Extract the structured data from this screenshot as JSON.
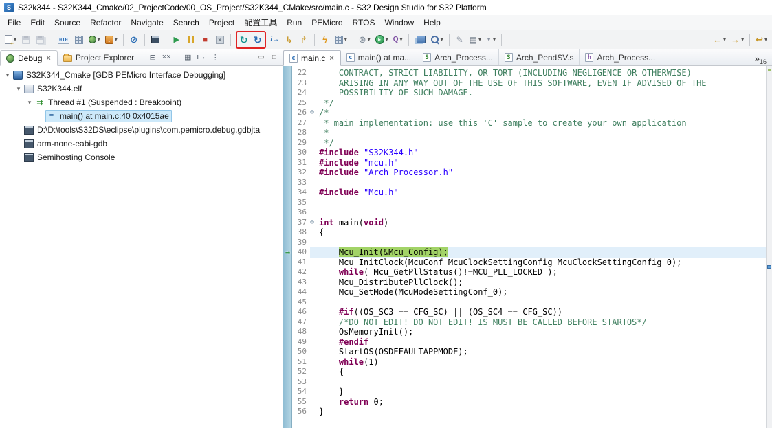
{
  "window": {
    "title": "S32k344 - S32K344_Cmake/02_ProjectCode/00_OS_Project/S32K344_CMake/src/main.c - S32 Design Studio for S32 Platform",
    "app_initial": "S"
  },
  "menubar": {
    "items": [
      "File",
      "Edit",
      "Source",
      "Refactor",
      "Navigate",
      "Search",
      "Project",
      "配置工具",
      "Run",
      "PEMicro",
      "RTOS",
      "Window",
      "Help"
    ]
  },
  "toolbar": {
    "items": [
      {
        "name": "new-wizard",
        "icon": "doc",
        "dd": true
      },
      {
        "name": "save",
        "icon": "floppy",
        "disabled": true
      },
      {
        "name": "save-all",
        "icon": "floppy2",
        "disabled": true
      },
      {
        "sep": true
      },
      {
        "name": "binary-utilities",
        "icon": "t010"
      },
      {
        "name": "view-memory",
        "icon": "grid"
      },
      {
        "name": "debug-configurations",
        "icon": "bug",
        "dd": true
      },
      {
        "name": "flash-from-file",
        "icon": "flash",
        "dd": true
      },
      {
        "sep": true
      },
      {
        "name": "skip-all-breakpoints",
        "icon": "skipbp"
      },
      {
        "sep": true
      },
      {
        "name": "open-console",
        "icon": "console"
      },
      {
        "sep": true
      },
      {
        "name": "resume",
        "icon": "resume"
      },
      {
        "name": "suspend",
        "icon": "suspend"
      },
      {
        "name": "terminate",
        "icon": "stop"
      },
      {
        "name": "disconnect",
        "icon": "disconnect"
      },
      {
        "sep": true
      },
      {
        "name": "pemicro-restart",
        "icon": "restart1",
        "boxed": true
      },
      {
        "name": "pemicro-restart-run",
        "icon": "restart2",
        "boxed": true
      },
      {
        "name": "instruction-stepping",
        "icon": "istep"
      },
      {
        "name": "step-into",
        "icon": "stepinto"
      },
      {
        "name": "step-over",
        "icon": "stepover"
      },
      {
        "sep": true
      },
      {
        "name": "flash-programmer",
        "icon": "bolt"
      },
      {
        "name": "memory-monitor",
        "icon": "grid2",
        "dd": true
      },
      {
        "sep": true
      },
      {
        "name": "external-tools",
        "icon": "gear",
        "dd": true
      },
      {
        "name": "run",
        "icon": "run",
        "dd": true
      },
      {
        "name": "profile",
        "icon": "cov",
        "dd": true
      },
      {
        "sep": true
      },
      {
        "name": "open-element",
        "icon": "books"
      },
      {
        "name": "search",
        "icon": "search",
        "dd": true
      },
      {
        "sep": true
      },
      {
        "name": "annotate",
        "icon": "pencil"
      },
      {
        "name": "mark-occurrences",
        "icon": "list",
        "dd": true
      },
      {
        "name": "filters",
        "icon": "filter",
        "dd": true
      },
      {
        "sep": true
      },
      {
        "name": "back",
        "icon": "navback",
        "dd": true,
        "right": true
      },
      {
        "name": "forward",
        "icon": "navfwd",
        "dd": true
      },
      {
        "sep": true
      },
      {
        "name": "last-edit-location",
        "icon": "navlast",
        "dd": true
      }
    ]
  },
  "debug_panel": {
    "tabs": [
      {
        "label": "Debug",
        "selected": true,
        "closable": true,
        "icon": "bug"
      },
      {
        "label": "Project Explorer",
        "icon": "folder"
      }
    ],
    "toolbar": [
      {
        "name": "collapse-all",
        "glyph": "⊟"
      },
      {
        "name": "remove-all-terminated",
        "glyph": "××"
      },
      {
        "sep": true
      },
      {
        "name": "debug-view-layout",
        "glyph": "▦"
      },
      {
        "name": "instruction-stepping-mode",
        "glyph": "i→"
      },
      {
        "name": "view-menu",
        "glyph": "⋮"
      }
    ],
    "window_controls": [
      {
        "name": "minimize",
        "glyph": "▭"
      },
      {
        "name": "maximize",
        "glyph": "□"
      }
    ],
    "tree": [
      {
        "label": "S32K344_Cmake [GDB PEMicro Interface Debugging]",
        "level": 0,
        "expanded": true,
        "icon": "launch"
      },
      {
        "label": "S32K344.elf",
        "level": 1,
        "expanded": true,
        "icon": "elf"
      },
      {
        "label": "Thread #1 (Suspended : Breakpoint)",
        "level": 2,
        "expanded": true,
        "icon": "thread"
      },
      {
        "label": "main() at main.c:40 0x4015ae",
        "level": 3,
        "icon": "frame",
        "selected": true
      },
      {
        "label": "D:\\D:\\tools\\S32DS\\eclipse\\plugins\\com.pemicro.debug.gdbjta",
        "level": 1,
        "icon": "console"
      },
      {
        "label": "arm-none-eabi-gdb",
        "level": 1,
        "icon": "console"
      },
      {
        "label": "Semihosting Console",
        "level": 1,
        "icon": "console"
      }
    ]
  },
  "editor": {
    "tabs": [
      {
        "label": "main.c",
        "ficon": "fc",
        "letter": "c",
        "selected": true,
        "closable": true
      },
      {
        "label": "main() at ma...",
        "ficon": "fc",
        "letter": "c"
      },
      {
        "label": "Arch_Process...",
        "ficon": "fs",
        "letter": "S"
      },
      {
        "label": "Arch_PendSV.s",
        "ficon": "fs",
        "letter": "S"
      },
      {
        "label": "Arch_Process...",
        "ficon": "fh",
        "letter": "h"
      }
    ],
    "overflow": {
      "symbol": "»",
      "count": "16"
    },
    "lines": [
      {
        "n": 22,
        "segs": [
          {
            "c": "comment",
            "t": "    CONTRACT, STRICT LIABILITY, OR TORT (INCLUDING NEGLIGENCE OR OTHERWISE)"
          }
        ]
      },
      {
        "n": 23,
        "segs": [
          {
            "c": "comment",
            "t": "    ARISING IN ANY WAY OUT OF THE USE OF THIS SOFTWARE, EVEN IF ADVISED OF THE"
          }
        ]
      },
      {
        "n": 24,
        "segs": [
          {
            "c": "comment",
            "t": "    POSSIBILITY OF SUCH DAMAGE."
          }
        ]
      },
      {
        "n": 25,
        "segs": [
          {
            "c": "comment",
            "t": " */"
          }
        ]
      },
      {
        "n": 26,
        "fold": true,
        "segs": [
          {
            "c": "comment",
            "t": "/*"
          }
        ]
      },
      {
        "n": 27,
        "segs": [
          {
            "c": "comment",
            "t": " * main implementation: use this 'C' sample to create your own application"
          }
        ]
      },
      {
        "n": 28,
        "segs": [
          {
            "c": "comment",
            "t": " *"
          }
        ]
      },
      {
        "n": 29,
        "segs": [
          {
            "c": "comment",
            "t": " */"
          }
        ]
      },
      {
        "n": 30,
        "segs": [
          {
            "c": "directive",
            "t": "#include"
          },
          {
            "c": "plain",
            "t": " "
          },
          {
            "c": "string",
            "t": "\"S32K344.h\""
          }
        ]
      },
      {
        "n": 31,
        "segs": [
          {
            "c": "directive",
            "t": "#include"
          },
          {
            "c": "plain",
            "t": " "
          },
          {
            "c": "string",
            "t": "\"mcu.h\""
          }
        ]
      },
      {
        "n": 32,
        "segs": [
          {
            "c": "directive",
            "t": "#include"
          },
          {
            "c": "plain",
            "t": " "
          },
          {
            "c": "string",
            "t": "\"Arch_Processor.h\""
          }
        ]
      },
      {
        "n": 33,
        "segs": []
      },
      {
        "n": 34,
        "segs": [
          {
            "c": "directive",
            "t": "#include"
          },
          {
            "c": "plain",
            "t": " "
          },
          {
            "c": "string",
            "t": "\"Mcu.h\""
          }
        ]
      },
      {
        "n": 35,
        "segs": []
      },
      {
        "n": 36,
        "segs": []
      },
      {
        "n": 37,
        "fold": true,
        "segs": [
          {
            "c": "keyword",
            "t": "int"
          },
          {
            "c": "plain",
            "t": " main("
          },
          {
            "c": "keyword",
            "t": "void"
          },
          {
            "c": "plain",
            "t": ")"
          }
        ]
      },
      {
        "n": 38,
        "segs": [
          {
            "c": "plain",
            "t": "{"
          }
        ]
      },
      {
        "n": 39,
        "segs": []
      },
      {
        "n": 40,
        "current": true,
        "segs": [
          {
            "c": "plain",
            "t": "    "
          },
          {
            "c": "stmt",
            "t": "Mcu_Init(&Mcu_Config);"
          }
        ]
      },
      {
        "n": 41,
        "segs": [
          {
            "c": "plain",
            "t": "    Mcu_InitClock(McuConf_McuClockSettingConfig_McuClockSettingConfig_0);"
          }
        ]
      },
      {
        "n": 42,
        "segs": [
          {
            "c": "plain",
            "t": "    "
          },
          {
            "c": "keyword",
            "t": "while"
          },
          {
            "c": "plain",
            "t": "( Mcu_GetPllStatus()!=MCU_PLL_LOCKED );"
          }
        ]
      },
      {
        "n": 43,
        "segs": [
          {
            "c": "plain",
            "t": "    Mcu_DistributePllClock();"
          }
        ]
      },
      {
        "n": 44,
        "segs": [
          {
            "c": "plain",
            "t": "    Mcu_SetMode(McuModeSettingConf_0);"
          }
        ]
      },
      {
        "n": 45,
        "segs": []
      },
      {
        "n": 46,
        "segs": [
          {
            "c": "plain",
            "t": "    "
          },
          {
            "c": "directive",
            "t": "#if"
          },
          {
            "c": "plain",
            "t": "((OS_SC3 == CFG_SC) || (OS_SC4 == CFG_SC))"
          }
        ]
      },
      {
        "n": 47,
        "segs": [
          {
            "c": "plain",
            "t": "    "
          },
          {
            "c": "comment",
            "t": "/*DO NOT EDIT! DO NOT EDIT! IS MUST BE CALLED BEFORE STARTOS*/"
          }
        ]
      },
      {
        "n": 48,
        "segs": [
          {
            "c": "plain",
            "t": "    OsMemoryInit();"
          }
        ]
      },
      {
        "n": 49,
        "segs": [
          {
            "c": "plain",
            "t": "    "
          },
          {
            "c": "directive",
            "t": "#endif"
          }
        ]
      },
      {
        "n": 50,
        "segs": [
          {
            "c": "plain",
            "t": "    StartOS(OSDEFAULTAPPMODE);"
          }
        ]
      },
      {
        "n": 51,
        "segs": [
          {
            "c": "plain",
            "t": "    "
          },
          {
            "c": "keyword",
            "t": "while"
          },
          {
            "c": "plain",
            "t": "(1)"
          }
        ]
      },
      {
        "n": 52,
        "segs": [
          {
            "c": "plain",
            "t": "    {"
          }
        ]
      },
      {
        "n": 53,
        "segs": []
      },
      {
        "n": 54,
        "segs": [
          {
            "c": "plain",
            "t": "    }"
          }
        ]
      },
      {
        "n": 55,
        "segs": [
          {
            "c": "plain",
            "t": "    "
          },
          {
            "c": "keyword",
            "t": "return"
          },
          {
            "c": "plain",
            "t": " 0;"
          }
        ]
      },
      {
        "n": 56,
        "segs": [
          {
            "c": "plain",
            "t": "}"
          }
        ]
      }
    ]
  },
  "colors": {
    "comment": "#3f7f5f",
    "keyword": "#7f0055",
    "string": "#2a00ff",
    "current_statement_bg": "#a2d367",
    "current_line_bg": "#e1effa",
    "selection_bg": "#cde9fa",
    "highlight_box": "#e02424"
  }
}
